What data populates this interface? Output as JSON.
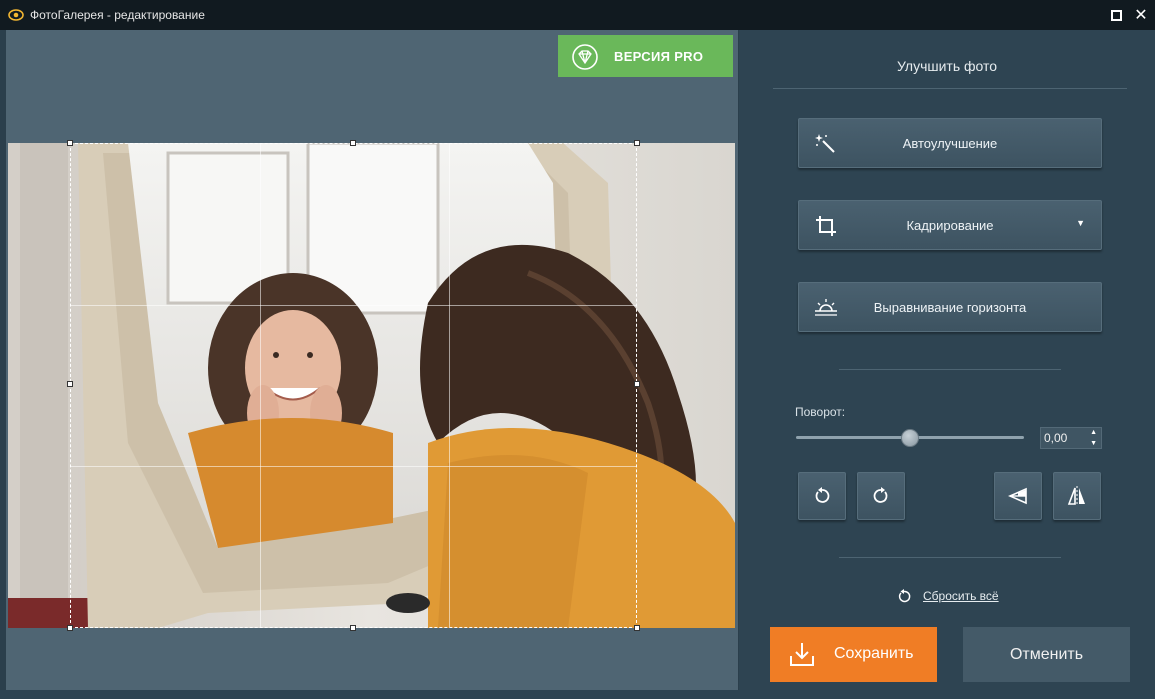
{
  "window": {
    "title": "ФотоГалерея - редактирование",
    "icons": {
      "app": "eye-icon",
      "maximize": "maximize-icon",
      "close": "close-icon"
    }
  },
  "canvas": {
    "pro_button": {
      "label": "ВЕРСИЯ PRO",
      "icon": "diamond-icon",
      "color": "#6ab85a"
    },
    "photo": {
      "description_icon": "photo-image"
    }
  },
  "panel": {
    "title": "Улучшить фото",
    "tools": [
      {
        "label": "Автоулучшение",
        "icon": "magic-wand-icon"
      },
      {
        "label": "Кадрирование",
        "icon": "crop-icon",
        "dropdown": true
      },
      {
        "label": "Выравнивание горизонта",
        "icon": "horizon-icon"
      }
    ],
    "rotation": {
      "label": "Поворот:",
      "value": "0,00",
      "slider_fraction": 0.5
    },
    "transform_buttons": [
      {
        "name": "rotate-left",
        "icon": "rotate-left-icon"
      },
      {
        "name": "rotate-right",
        "icon": "rotate-right-icon"
      },
      {
        "name": "flip-vertical",
        "icon": "flip-vertical-icon"
      },
      {
        "name": "flip-horizontal",
        "icon": "flip-horizontal-icon"
      }
    ],
    "reset_label": "Сбросить всё",
    "save_label": "Сохранить",
    "cancel_label": "Отменить",
    "colors": {
      "accent": "#f07d25",
      "panel_bg": "#2e4452",
      "canvas_bg": "#4f6573"
    }
  }
}
